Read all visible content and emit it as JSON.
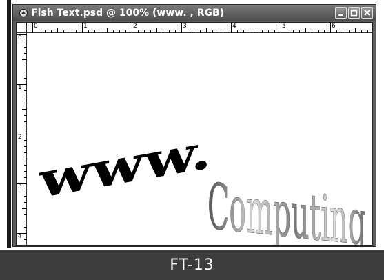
{
  "window": {
    "title": "Fish Text.psd @ 100% (www. , RGB)",
    "buttons": {
      "minimize": "minimize-icon",
      "maximize": "maximize-icon",
      "close": "close-icon"
    }
  },
  "rulers": {
    "horizontal": [
      "0",
      "1",
      "2",
      "3",
      "4",
      "5",
      "6"
    ],
    "vertical": [
      "0",
      "1",
      "2",
      "3",
      "4"
    ]
  },
  "artwork": {
    "black_text": "www.",
    "chrome_text": "Computing",
    "colors": {
      "black": "#000000",
      "chrome_light": "#d9d9d9",
      "chrome_dark": "#555555"
    }
  },
  "caption": "FT-13"
}
